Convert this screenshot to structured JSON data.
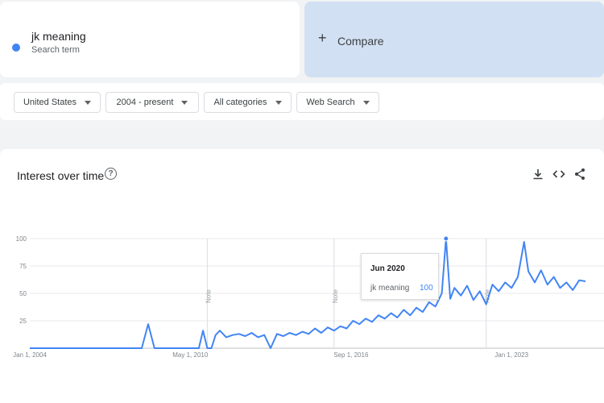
{
  "search_term": {
    "name": "jk meaning",
    "subtitle": "Search term",
    "color": "#4285f4"
  },
  "compare": {
    "label": "Compare",
    "icon": "plus-icon",
    "bg_color": "#d2e0f3"
  },
  "filters": [
    {
      "label": "United States"
    },
    {
      "label": "2004 - present"
    },
    {
      "label": "All categories"
    },
    {
      "label": "Web Search"
    }
  ],
  "chart_card": {
    "title": "Interest over time",
    "help_icon": "help-circle-icon",
    "tools": [
      "download-icon",
      "embed-code-icon",
      "share-icon"
    ]
  },
  "tooltip": {
    "date": "Jun 2020",
    "term": "jk meaning",
    "value": "100"
  },
  "chart_data": {
    "type": "line",
    "ylim": [
      0,
      100
    ],
    "y_ticks": [
      0,
      25,
      50,
      75,
      100
    ],
    "y_tick_labels": [
      "",
      "25",
      "50",
      "75",
      "100"
    ],
    "x_range": [
      "2004-01-01",
      "2025-12-01"
    ],
    "x_ticks": [
      {
        "date": "2004-01-01",
        "label": "Jan 1, 2004"
      },
      {
        "date": "2010-05-01",
        "label": "May 1, 2010"
      },
      {
        "date": "2016-09-01",
        "label": "Sep 1, 2016"
      },
      {
        "date": "2023-01-01",
        "label": "Jan 1, 2023"
      }
    ],
    "notes": [
      {
        "date": "2011-01-01",
        "label": "Note"
      },
      {
        "date": "2016-01-01",
        "label": "Note"
      },
      {
        "date": "2022-01-01",
        "label": "Note"
      }
    ],
    "highlight": {
      "date": "2020-06-01",
      "value": 100
    },
    "grid": true,
    "series": [
      {
        "name": "jk meaning",
        "color": "#4285f4",
        "points": [
          [
            "2004-01-01",
            0
          ],
          [
            "2008-06-01",
            0
          ],
          [
            "2008-09-01",
            22
          ],
          [
            "2008-12-01",
            0
          ],
          [
            "2010-05-01",
            0
          ],
          [
            "2010-09-01",
            0
          ],
          [
            "2010-11-01",
            16
          ],
          [
            "2011-01-01",
            0
          ],
          [
            "2011-03-01",
            0
          ],
          [
            "2011-05-01",
            12
          ],
          [
            "2011-07-01",
            16
          ],
          [
            "2011-10-01",
            10
          ],
          [
            "2012-01-01",
            12
          ],
          [
            "2012-04-01",
            13
          ],
          [
            "2012-07-01",
            11
          ],
          [
            "2012-10-01",
            14
          ],
          [
            "2013-01-01",
            10
          ],
          [
            "2013-04-01",
            12
          ],
          [
            "2013-07-01",
            0
          ],
          [
            "2013-10-01",
            13
          ],
          [
            "2014-01-01",
            11
          ],
          [
            "2014-04-01",
            14
          ],
          [
            "2014-07-01",
            12
          ],
          [
            "2014-10-01",
            15
          ],
          [
            "2015-01-01",
            13
          ],
          [
            "2015-04-01",
            18
          ],
          [
            "2015-07-01",
            14
          ],
          [
            "2015-10-01",
            19
          ],
          [
            "2016-01-01",
            16
          ],
          [
            "2016-04-01",
            20
          ],
          [
            "2016-07-01",
            18
          ],
          [
            "2016-10-01",
            25
          ],
          [
            "2017-01-01",
            22
          ],
          [
            "2017-04-01",
            27
          ],
          [
            "2017-07-01",
            24
          ],
          [
            "2017-10-01",
            30
          ],
          [
            "2018-01-01",
            27
          ],
          [
            "2018-04-01",
            32
          ],
          [
            "2018-07-01",
            28
          ],
          [
            "2018-10-01",
            35
          ],
          [
            "2019-01-01",
            30
          ],
          [
            "2019-04-01",
            37
          ],
          [
            "2019-07-01",
            33
          ],
          [
            "2019-10-01",
            42
          ],
          [
            "2020-01-01",
            38
          ],
          [
            "2020-04-01",
            50
          ],
          [
            "2020-06-01",
            100
          ],
          [
            "2020-08-01",
            45
          ],
          [
            "2020-10-01",
            55
          ],
          [
            "2021-01-01",
            48
          ],
          [
            "2021-04-01",
            57
          ],
          [
            "2021-07-01",
            44
          ],
          [
            "2021-10-01",
            52
          ],
          [
            "2022-01-01",
            40
          ],
          [
            "2022-04-01",
            58
          ],
          [
            "2022-07-01",
            52
          ],
          [
            "2022-10-01",
            60
          ],
          [
            "2023-01-01",
            55
          ],
          [
            "2023-04-01",
            65
          ],
          [
            "2023-07-01",
            97
          ],
          [
            "2023-09-01",
            70
          ],
          [
            "2023-12-01",
            60
          ],
          [
            "2024-03-01",
            71
          ],
          [
            "2024-06-01",
            58
          ],
          [
            "2024-09-01",
            65
          ],
          [
            "2024-12-01",
            55
          ],
          [
            "2025-03-01",
            60
          ],
          [
            "2025-06-01",
            53
          ],
          [
            "2025-09-01",
            62
          ],
          [
            "2025-12-01",
            61
          ]
        ]
      }
    ]
  }
}
